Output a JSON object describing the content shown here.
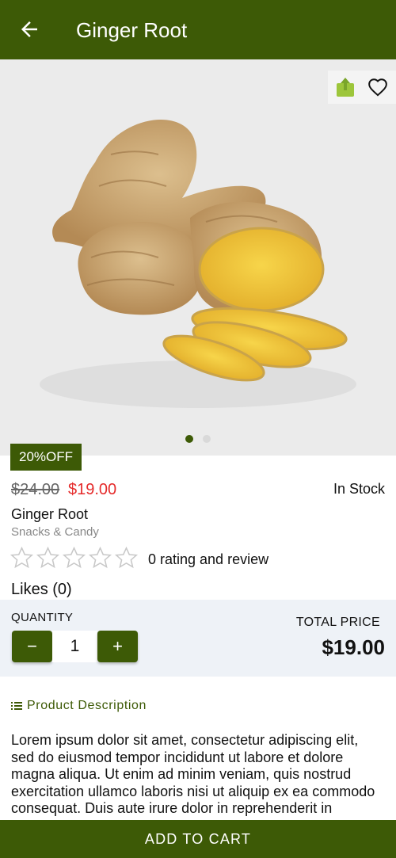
{
  "appbar": {
    "title": "Ginger Root"
  },
  "carousel": {
    "page_count": 2,
    "active_page": 1
  },
  "product": {
    "discount_badge": "20%OFF",
    "old_price": "$24.00",
    "price": "$19.00",
    "stock_status": "In Stock",
    "name": "Ginger Root",
    "category": "Snacks & Candy",
    "rating": 0,
    "max_rating": 5,
    "rating_text": "0 rating and review",
    "likes_text": "Likes (0)"
  },
  "quantity": {
    "label": "QUANTITY",
    "decrement": "−",
    "value": "1",
    "increment": "+",
    "total_label": "TOTAL PRICE",
    "total_value": "$19.00"
  },
  "description": {
    "heading": "Product Description",
    "body": "Lorem ipsum dolor sit amet, consectetur adipiscing elit, sed do eiusmod tempor incididunt ut labore et dolore magna aliqua. Ut enim ad minim veniam, quis nostrud exercitation ullamco laboris nisi ut aliquip ex ea commodo consequat. Duis aute irure dolor in reprehenderit in voluptate velit esse cillum dolore"
  },
  "footer": {
    "add_to_cart": "ADD TO CART"
  },
  "colors": {
    "brand": "#3d5a06",
    "sale": "#e52b2b",
    "share_icon": "#9dc63b"
  },
  "icons": [
    "arrow-left-icon",
    "share-icon",
    "heart-icon",
    "star-icon",
    "list-icon"
  ]
}
